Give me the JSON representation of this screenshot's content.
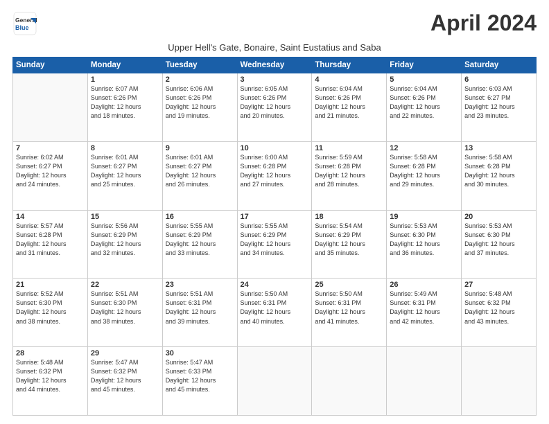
{
  "header": {
    "logo_line1": "General",
    "logo_line2": "Blue",
    "month_title": "April 2024",
    "subtitle": "Upper Hell's Gate, Bonaire, Saint Eustatius and Saba"
  },
  "weekdays": [
    "Sunday",
    "Monday",
    "Tuesday",
    "Wednesday",
    "Thursday",
    "Friday",
    "Saturday"
  ],
  "weeks": [
    [
      {
        "day": "",
        "info": ""
      },
      {
        "day": "1",
        "info": "Sunrise: 6:07 AM\nSunset: 6:26 PM\nDaylight: 12 hours\nand 18 minutes."
      },
      {
        "day": "2",
        "info": "Sunrise: 6:06 AM\nSunset: 6:26 PM\nDaylight: 12 hours\nand 19 minutes."
      },
      {
        "day": "3",
        "info": "Sunrise: 6:05 AM\nSunset: 6:26 PM\nDaylight: 12 hours\nand 20 minutes."
      },
      {
        "day": "4",
        "info": "Sunrise: 6:04 AM\nSunset: 6:26 PM\nDaylight: 12 hours\nand 21 minutes."
      },
      {
        "day": "5",
        "info": "Sunrise: 6:04 AM\nSunset: 6:26 PM\nDaylight: 12 hours\nand 22 minutes."
      },
      {
        "day": "6",
        "info": "Sunrise: 6:03 AM\nSunset: 6:27 PM\nDaylight: 12 hours\nand 23 minutes."
      }
    ],
    [
      {
        "day": "7",
        "info": "Sunrise: 6:02 AM\nSunset: 6:27 PM\nDaylight: 12 hours\nand 24 minutes."
      },
      {
        "day": "8",
        "info": "Sunrise: 6:01 AM\nSunset: 6:27 PM\nDaylight: 12 hours\nand 25 minutes."
      },
      {
        "day": "9",
        "info": "Sunrise: 6:01 AM\nSunset: 6:27 PM\nDaylight: 12 hours\nand 26 minutes."
      },
      {
        "day": "10",
        "info": "Sunrise: 6:00 AM\nSunset: 6:28 PM\nDaylight: 12 hours\nand 27 minutes."
      },
      {
        "day": "11",
        "info": "Sunrise: 5:59 AM\nSunset: 6:28 PM\nDaylight: 12 hours\nand 28 minutes."
      },
      {
        "day": "12",
        "info": "Sunrise: 5:58 AM\nSunset: 6:28 PM\nDaylight: 12 hours\nand 29 minutes."
      },
      {
        "day": "13",
        "info": "Sunrise: 5:58 AM\nSunset: 6:28 PM\nDaylight: 12 hours\nand 30 minutes."
      }
    ],
    [
      {
        "day": "14",
        "info": "Sunrise: 5:57 AM\nSunset: 6:28 PM\nDaylight: 12 hours\nand 31 minutes."
      },
      {
        "day": "15",
        "info": "Sunrise: 5:56 AM\nSunset: 6:29 PM\nDaylight: 12 hours\nand 32 minutes."
      },
      {
        "day": "16",
        "info": "Sunrise: 5:55 AM\nSunset: 6:29 PM\nDaylight: 12 hours\nand 33 minutes."
      },
      {
        "day": "17",
        "info": "Sunrise: 5:55 AM\nSunset: 6:29 PM\nDaylight: 12 hours\nand 34 minutes."
      },
      {
        "day": "18",
        "info": "Sunrise: 5:54 AM\nSunset: 6:29 PM\nDaylight: 12 hours\nand 35 minutes."
      },
      {
        "day": "19",
        "info": "Sunrise: 5:53 AM\nSunset: 6:30 PM\nDaylight: 12 hours\nand 36 minutes."
      },
      {
        "day": "20",
        "info": "Sunrise: 5:53 AM\nSunset: 6:30 PM\nDaylight: 12 hours\nand 37 minutes."
      }
    ],
    [
      {
        "day": "21",
        "info": "Sunrise: 5:52 AM\nSunset: 6:30 PM\nDaylight: 12 hours\nand 38 minutes."
      },
      {
        "day": "22",
        "info": "Sunrise: 5:51 AM\nSunset: 6:30 PM\nDaylight: 12 hours\nand 38 minutes."
      },
      {
        "day": "23",
        "info": "Sunrise: 5:51 AM\nSunset: 6:31 PM\nDaylight: 12 hours\nand 39 minutes."
      },
      {
        "day": "24",
        "info": "Sunrise: 5:50 AM\nSunset: 6:31 PM\nDaylight: 12 hours\nand 40 minutes."
      },
      {
        "day": "25",
        "info": "Sunrise: 5:50 AM\nSunset: 6:31 PM\nDaylight: 12 hours\nand 41 minutes."
      },
      {
        "day": "26",
        "info": "Sunrise: 5:49 AM\nSunset: 6:31 PM\nDaylight: 12 hours\nand 42 minutes."
      },
      {
        "day": "27",
        "info": "Sunrise: 5:48 AM\nSunset: 6:32 PM\nDaylight: 12 hours\nand 43 minutes."
      }
    ],
    [
      {
        "day": "28",
        "info": "Sunrise: 5:48 AM\nSunset: 6:32 PM\nDaylight: 12 hours\nand 44 minutes."
      },
      {
        "day": "29",
        "info": "Sunrise: 5:47 AM\nSunset: 6:32 PM\nDaylight: 12 hours\nand 45 minutes."
      },
      {
        "day": "30",
        "info": "Sunrise: 5:47 AM\nSunset: 6:33 PM\nDaylight: 12 hours\nand 45 minutes."
      },
      {
        "day": "",
        "info": ""
      },
      {
        "day": "",
        "info": ""
      },
      {
        "day": "",
        "info": ""
      },
      {
        "day": "",
        "info": ""
      }
    ]
  ]
}
